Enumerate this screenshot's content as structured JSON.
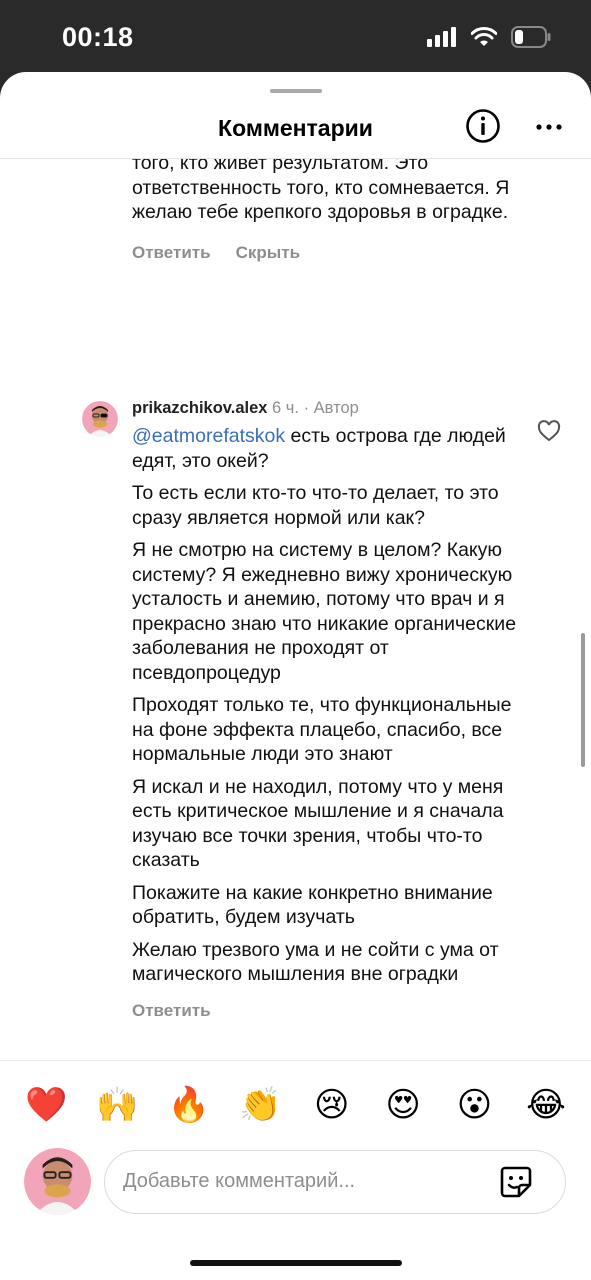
{
  "status_bar": {
    "time": "00:18"
  },
  "header": {
    "title": "Комментарии"
  },
  "previous_comment": {
    "lines": [
      "того, кто живет результатом. Это ответственность того, кто сомневается.  Я желаю тебе крепкого здоровья в оградке."
    ],
    "reply_label": "Ответить",
    "hide_label": "Скрыть"
  },
  "comment": {
    "username": "prikazchikov.alex",
    "time": "6 ч.",
    "separator": "·",
    "author_badge": "Автор",
    "mention": "@eatmorefatskok",
    "paragraphs": [
      " есть острова где людей едят, это окей?",
      "То есть если кто-то что-то делает, то это сразу является нормой или как?",
      "Я не смотрю на систему в целом? Какую систему? Я ежедневно вижу хроническую усталость и анемию, потому что врач и я прекрасно знаю что никакие органические заболевания не проходят от псевдопроцедур",
      "Проходят только те, что функциональные на фоне эффекта плацебо, спасибо, все нормальные люди это знают",
      "Я искал и не находил, потому что у меня есть критическое мышление и я сначала изучаю все точки зрения, чтобы что-то сказать",
      "Покажите на какие конкретно внимание обратить, будем изучать",
      "Желаю трезвого ума и не сойти с ума от магического мышления вне оградки"
    ],
    "reply_label": "Ответить"
  },
  "reactions": [
    "❤️",
    "🙌",
    "🔥",
    "👏",
    "😢",
    "😍",
    "😮",
    "😂"
  ],
  "composer": {
    "placeholder": "Добавьте комментарий..."
  },
  "colors": {
    "mention": "#3b6fb6",
    "secondary_text": "#8e8e8e",
    "status_bar_bg": "#2a2a2a"
  }
}
